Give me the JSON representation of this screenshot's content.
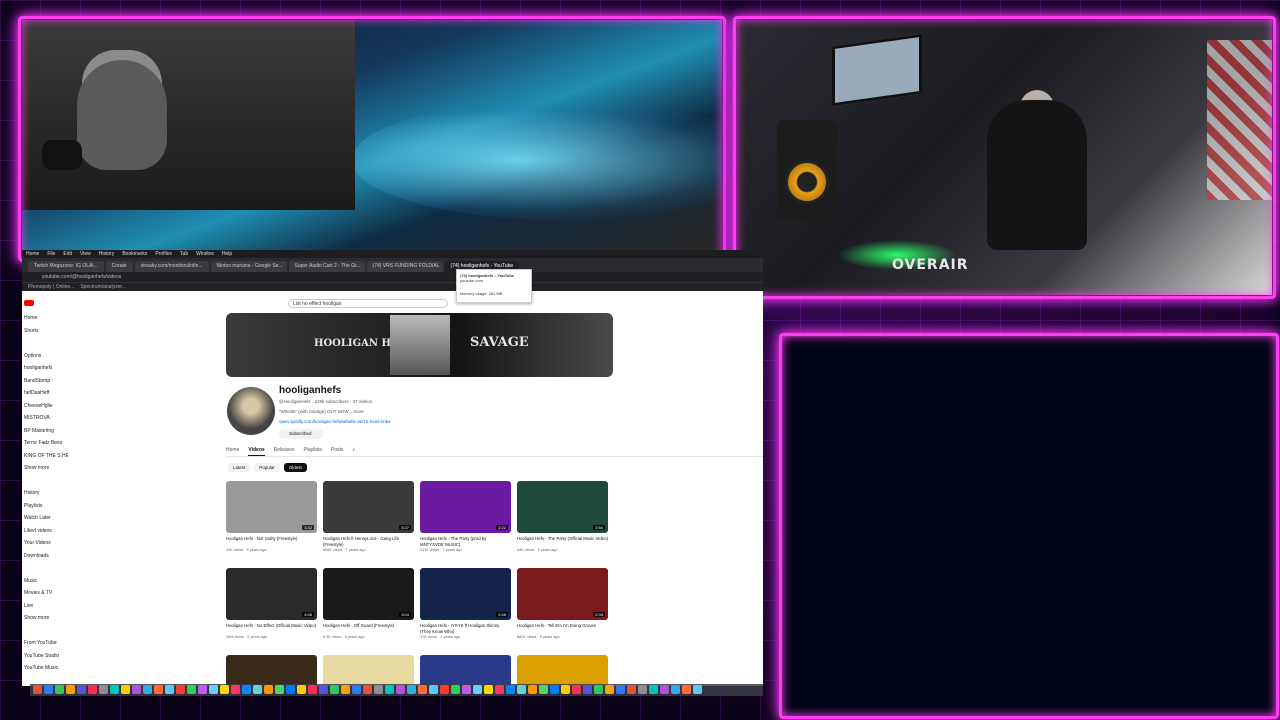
{
  "stream": {
    "studio_sign": "OVERAIR"
  },
  "browser": {
    "menubar": [
      "Home",
      "File",
      "Edit",
      "View",
      "History",
      "Bookmarks",
      "Profiles",
      "Tab",
      "Window",
      "Help"
    ],
    "tabs": [
      {
        "label": "Twitch Megazone: IG OLAl...",
        "active": false
      },
      {
        "label": "Create",
        "active": false
      },
      {
        "label": "streaky.com/monitors/infin...",
        "active": false
      },
      {
        "label": "Nintoo mariana - Google Se...",
        "active": false
      },
      {
        "label": "Super Audio Cart 2 - The Gr...",
        "active": false
      },
      {
        "label": "(74) VRS FUNDING FOLDIAL",
        "active": false
      },
      {
        "label": "(74) hooliganhefs - YouTube",
        "active": true
      }
    ],
    "url": "youtube.com/@hooliganhefs/videos",
    "bookmarks": [
      "Phonopoly | Online...",
      "Spectrum/analyzer..."
    ],
    "tooltip": {
      "title": "(74) hooliganhefs – YouTube",
      "domain": "youtube.com",
      "memory": "Memory usage: 481 MB"
    }
  },
  "youtube": {
    "search_value": "List no effect hooligan",
    "sidebar": [
      "Home",
      "Shorts",
      "",
      "Options",
      "hooliganhefs",
      "BandStomp",
      "hefDaaHeff",
      "CheeseHglie",
      "MISTROVA",
      "BP Mastering",
      "Terror Fadz Beez",
      "KING OF THE S.HE",
      "Show more",
      "",
      "History",
      "Playlists",
      "Watch Later",
      "Liked videos",
      "Your Videos",
      "Downloads",
      "",
      "Music",
      "Movies & TV",
      "Live",
      "Show more",
      "",
      "From YouTube",
      "YouTube Studio",
      "YouTube Music"
    ],
    "banner_left": "HOOLIGAN HEFS",
    "banner_right": "SAVAGE",
    "channel": {
      "name": "hooliganhefs",
      "handle_line": "@HooliganHefs · 229k subscribers · 37 videos",
      "desc": "\"Whistle\" (with Savage) OUT NOW ...more",
      "link": "open.spotify.com/hooligan-hefs/whistle and 5 more links",
      "subscribe": "Subscribed"
    },
    "tabs": [
      "Home",
      "Videos",
      "Releases",
      "Playlists",
      "Posts"
    ],
    "chips": [
      "Latest",
      "Popular",
      "Oldest"
    ],
    "videos": [
      {
        "title": "Hooligan Hefs - Not Guilty (Freestyle)",
        "meta": "44K views · 6 years ago",
        "dur": "3:42",
        "bg": "#9a9a9a"
      },
      {
        "title": "Hooligan Hefs ft HennyLoca - Gang Life (Freestyle)",
        "meta": "806K views · 7 years ago",
        "dur": "3:27",
        "bg": "#3a3a3a"
      },
      {
        "title": "Hooligan Hefs - The Party (prod by MNTYSVDE MUSIC)",
        "meta": "311K views · 7 years ago",
        "dur": "2:22",
        "bg": "#6a1aa0"
      },
      {
        "title": "Hooligan Hefs - The Party (Official Music Video)",
        "meta": "44K views · 5 years ago",
        "dur": "2:54",
        "bg": "#1f4a3a"
      },
      {
        "title": "Hooligan Hefs - No Effect (Official Music Video)",
        "meta": "19M views · 5 years ago",
        "dur": "4:06",
        "bg": "#2a2a2a"
      },
      {
        "title": "Hooligan Hefs - Off Guard (Freestyle)",
        "meta": "5.3K views · 5 years ago",
        "dur": "3:04",
        "bg": "#1a1a1a"
      },
      {
        "title": "Hooligan Hefs - IYKYK ft Hooligan Skinny (They Know Who)",
        "meta": "11K views · 4 years ago",
        "dur": "2:48",
        "bg": "#14234a"
      },
      {
        "title": "Hooligan Hefs - Tell Em I'm Doing Groves",
        "meta": "882K views · 5 years ago",
        "dur": "2:33",
        "bg": "#7a1a1a"
      },
      {
        "title": "",
        "meta": "",
        "dur": "",
        "bg": "#3a2a1a"
      },
      {
        "title": "",
        "meta": "",
        "dur": "",
        "bg": "#e8d9a0"
      },
      {
        "title": "",
        "meta": "",
        "dur": "",
        "bg": "#2a3a8a"
      },
      {
        "title": "",
        "meta": "",
        "dur": "",
        "bg": "#d9a000"
      }
    ]
  },
  "dock_colors": [
    "#e5533c",
    "#2f7df6",
    "#34c759",
    "#ff9f0a",
    "#5856d6",
    "#ff2d55",
    "#8e8e93",
    "#00c7be",
    "#ffcc00",
    "#af52de",
    "#32ade6",
    "#ff6b35",
    "#5ac8fa",
    "#ff3b30",
    "#30d158",
    "#bf5af2",
    "#64d2ff",
    "#ffd60a",
    "#ff375f",
    "#0a84ff",
    "#66d4cf",
    "#ff9500",
    "#4cd964",
    "#007aff",
    "#ffcc00",
    "#ff2d55",
    "#5856d6",
    "#34c759",
    "#ff9f0a",
    "#2f7df6",
    "#e5533c",
    "#8e8e93",
    "#00c7be",
    "#af52de",
    "#32ade6",
    "#ff6b35",
    "#5ac8fa",
    "#ff3b30",
    "#30d158",
    "#bf5af2",
    "#64d2ff",
    "#ffd60a",
    "#ff375f",
    "#0a84ff",
    "#66d4cf",
    "#ff9500",
    "#4cd964",
    "#007aff",
    "#ffcc00",
    "#ff2d55",
    "#5856d6",
    "#34c759",
    "#ff9f0a",
    "#2f7df6",
    "#e5533c",
    "#8e8e93",
    "#00c7be",
    "#af52de",
    "#32ade6",
    "#ff6b35",
    "#5ac8fa"
  ]
}
